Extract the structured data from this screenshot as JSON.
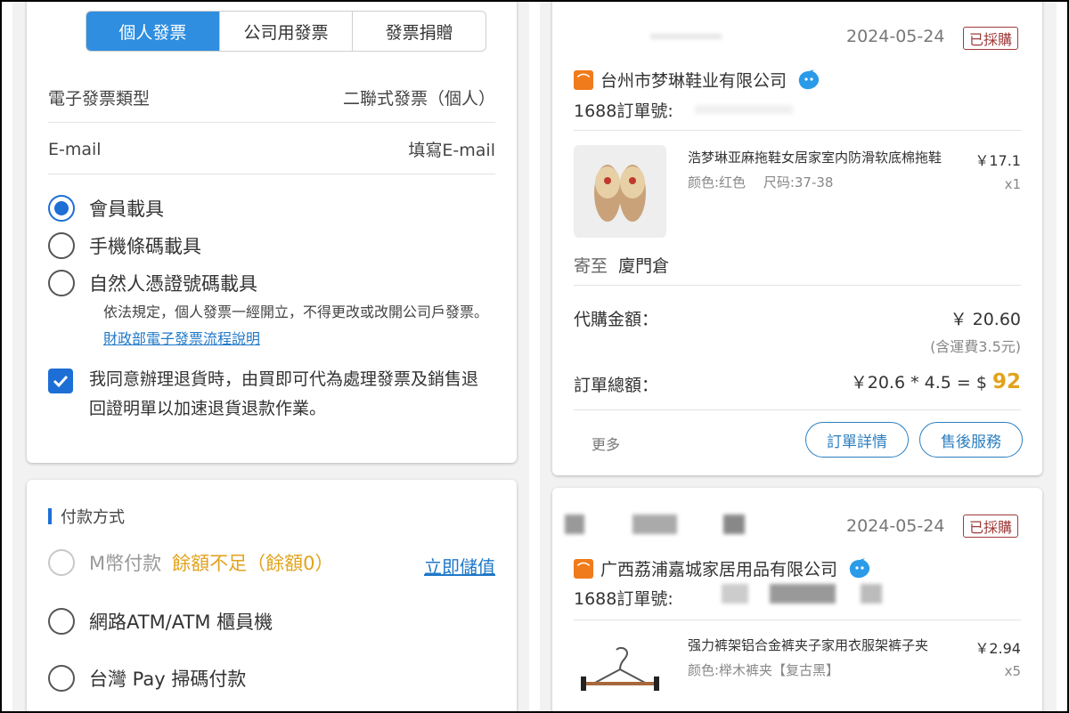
{
  "invoice": {
    "tabs": [
      "個人發票",
      "公司用發票",
      "發票捐贈"
    ],
    "active_tab": "個人發票",
    "type_label": "電子發票類型",
    "type_value": "二聯式發票（個人）",
    "email_label": "E-mail",
    "email_placeholder": "填寫E-mail",
    "carriers": [
      {
        "label": "會員載具",
        "selected": true
      },
      {
        "label": "手機條碼載具",
        "selected": false
      },
      {
        "label": "自然人憑證號碼載具",
        "selected": false
      }
    ],
    "note_text": "依法規定，個人發票一經開立，不得更改或改開公司戶發票。",
    "note_link": "財政部電子發票流程說明",
    "agree_text": "我同意辦理退貨時，由買即可代為處理發票及銷售退回證明單以加速退貨退款作業。",
    "agree_checked": true
  },
  "payment": {
    "title": "付款方式",
    "methods": [
      {
        "label": "M幣付款",
        "disabled": true,
        "warning": "餘額不足（餘額0）",
        "action": "立即儲值"
      },
      {
        "label": "網路ATM/ATM 櫃員機",
        "disabled": false
      },
      {
        "label": "台灣 Pay 掃碼付款",
        "disabled": false
      }
    ]
  },
  "orders": [
    {
      "date": "2024-05-24",
      "status": "已採購",
      "shop": "台州市梦琳鞋业有限公司",
      "order_no_label": "1688訂單號:",
      "product": {
        "name": "浩梦琳亚麻拖鞋女居家室内防滑软底棉拖鞋",
        "price": "￥17.1",
        "spec": "颜色:红色　 尺码:37-38",
        "qty": "x1"
      },
      "ship_to_label": "寄至",
      "ship_to": "廈門倉",
      "proxy_label": "代購金額：",
      "proxy_amount": "￥ 20.60",
      "shipping_note": "(含運費3.5元)",
      "total_label": "訂單總額：",
      "total_formula": "￥20.6 * 4.5 = $",
      "total_value": "92",
      "more": "更多",
      "btn_detail": "訂單詳情",
      "btn_service": "售後服務"
    },
    {
      "date": "2024-05-24",
      "status": "已採購",
      "shop": "广西荔浦嘉城家居用品有限公司",
      "order_no_label": "1688訂單號:",
      "product": {
        "name": "强力裤架铝合金裤夹子家用衣服架裤子夹",
        "price": "￥2.94",
        "spec": "颜色:榉木裤夹【复古黑】",
        "qty": "x5"
      }
    }
  ],
  "colors": {
    "accent": "#2f8ee0",
    "warning": "#e2a21b",
    "badge": "#a03a3a",
    "link": "#1f78c8"
  },
  "icons": [
    "radio-icon",
    "checkbox-check-icon",
    "shop-logo-icon",
    "wangwang-chat-icon",
    "slipper-image",
    "hanger-image"
  ]
}
